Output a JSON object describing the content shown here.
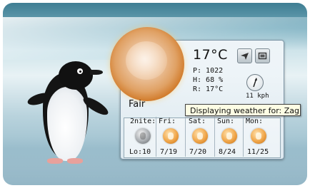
{
  "weather": {
    "temperature": "17°C",
    "pressure": "P: 1022",
    "humidity": "H: 68 %",
    "realfeel": "R: 17°C",
    "wind": "11 kph",
    "condition": "Fair",
    "tooltip": "Displaying weather for: Zagreb",
    "forecast": [
      {
        "day": "2nite:",
        "range": "Lo:10",
        "icon": "night-cloud-icon"
      },
      {
        "day": "Fri:",
        "range": "7/19",
        "icon": "sun-icon"
      },
      {
        "day": "Sat:",
        "range": "7/20",
        "icon": "sun-icon"
      },
      {
        "day": "Sun:",
        "range": "8/24",
        "icon": "sun-icon"
      },
      {
        "day": "Mon:",
        "range": "11/25",
        "icon": "sun-icon"
      }
    ]
  }
}
